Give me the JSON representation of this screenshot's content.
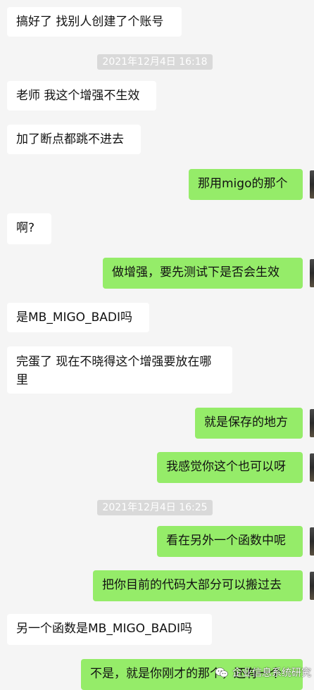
{
  "messages": [
    {
      "side": "in",
      "text": "搞好了 找别人创建了个账号"
    },
    {
      "side": "time",
      "text": "2021年12月4日 16:18"
    },
    {
      "side": "in",
      "text": "老师 我这个增强不生效"
    },
    {
      "side": "in",
      "text": "加了断点都跳不进去"
    },
    {
      "side": "out",
      "text": "那用migo的那个"
    },
    {
      "side": "in",
      "text": "啊?"
    },
    {
      "side": "out",
      "text": "做增强，要先测试下是否会生效"
    },
    {
      "side": "in",
      "text": "是MB_MIGO_BADI吗"
    },
    {
      "side": "in",
      "text": "完蛋了 现在不晓得这个增强要放在哪里"
    },
    {
      "side": "out",
      "text": "就是保存的地方"
    },
    {
      "side": "out",
      "text": "我感觉你这个也可以呀"
    },
    {
      "side": "time",
      "text": "2021年12月4日 16:25"
    },
    {
      "side": "out",
      "text": "看在另外一个函数中呢"
    },
    {
      "side": "out",
      "text": "把你目前的代码大部分可以搬过去"
    },
    {
      "side": "in",
      "text": "另一个函数是MB_MIGO_BADI吗"
    },
    {
      "side": "out",
      "text": "不是，就是你刚才的那个，还有一个"
    }
  ],
  "watermark": {
    "icon": "wechat-official-account-icon",
    "text": "企业信息系统研究"
  },
  "colors": {
    "background": "#f5f5f5",
    "incoming_bubble": "#ffffff",
    "outgoing_bubble": "#95ec69",
    "timestamp_bg": "#d9d9d9"
  }
}
